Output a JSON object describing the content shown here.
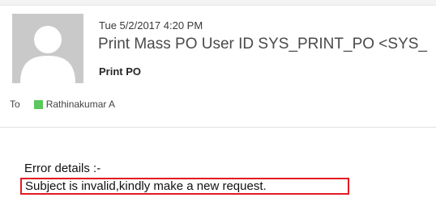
{
  "message": {
    "date": "Tue 5/2/2017 4:20 PM",
    "sender": "Print Mass PO User ID SYS_PRINT_PO <SYS_",
    "subject": "Print PO",
    "to_label": "To",
    "recipient": "Rathinakumar A"
  },
  "body": {
    "error_heading": "Error details :-",
    "error_message": "Subject is invalid,kindly make a new request."
  },
  "icons": {
    "avatar": "default-person-avatar",
    "presence": "online-presence-indicator"
  },
  "colors": {
    "presence": "#5ac85a",
    "highlight_border": "#e11b22",
    "avatar_bg": "#c9c9c9"
  }
}
